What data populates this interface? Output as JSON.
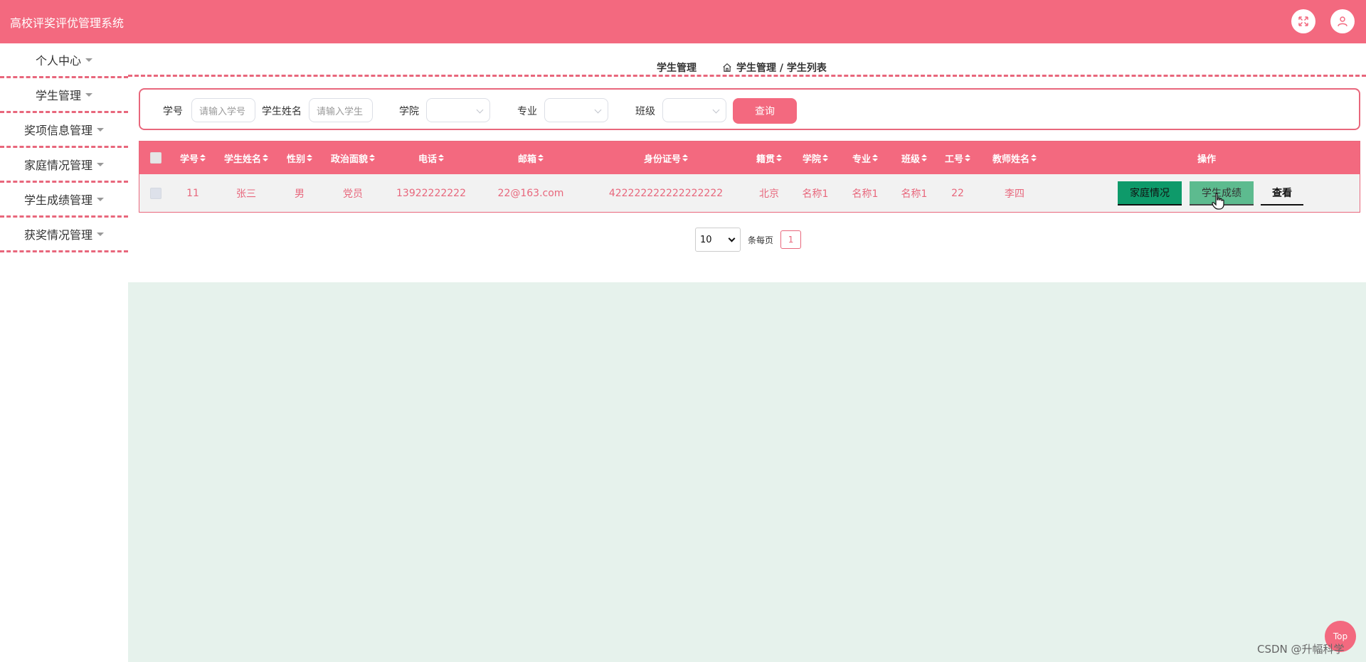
{
  "app": {
    "title": "高校评奖评优管理系统"
  },
  "header": {
    "icons": [
      "fullscreen-icon",
      "user-icon"
    ]
  },
  "sidebar": {
    "items": [
      {
        "label": "个人中心"
      },
      {
        "label": "学生管理"
      },
      {
        "label": "奖项信息管理"
      },
      {
        "label": "家庭情况管理"
      },
      {
        "label": "学生成绩管理"
      },
      {
        "label": "获奖情况管理"
      }
    ]
  },
  "breadcrumb": {
    "title": "学生管理",
    "path": "学生管理 / 学生列表"
  },
  "search": {
    "student_id_label": "学号",
    "student_id_placeholder": "请输入学号",
    "student_name_label": "学生姓名",
    "student_name_placeholder": "请输入学生",
    "college_label": "学院",
    "major_label": "专业",
    "class_label": "班级",
    "query_button": "查询"
  },
  "table": {
    "columns": [
      "学号",
      "学生姓名",
      "性别",
      "政治面貌",
      "电话",
      "邮箱",
      "身份证号",
      "籍贯",
      "学院",
      "专业",
      "班级",
      "工号",
      "教师姓名",
      "操作"
    ],
    "rows": [
      {
        "student_id": "11",
        "name": "张三",
        "gender": "男",
        "political": "党员",
        "phone": "13922222222",
        "email": "22@163.com",
        "id_card": "422222222222222222",
        "hometown": "北京",
        "college": "名称1",
        "major": "名称1",
        "class": "名称1",
        "teacher_id": "22",
        "teacher_name": "李四",
        "actions": {
          "family": "家庭情况",
          "score": "学生成绩",
          "view": "查看"
        }
      }
    ]
  },
  "pagination": {
    "page_size": "10",
    "per_page_label": "条每页",
    "current_page": "1"
  },
  "top_button": "Top",
  "watermark": "CSDN @升幅科学",
  "colors": {
    "primary": "#f3697f",
    "content_bg": "#e6f2ec",
    "family_button": "#0e9a6a",
    "score_button": "#5dbb8f"
  }
}
